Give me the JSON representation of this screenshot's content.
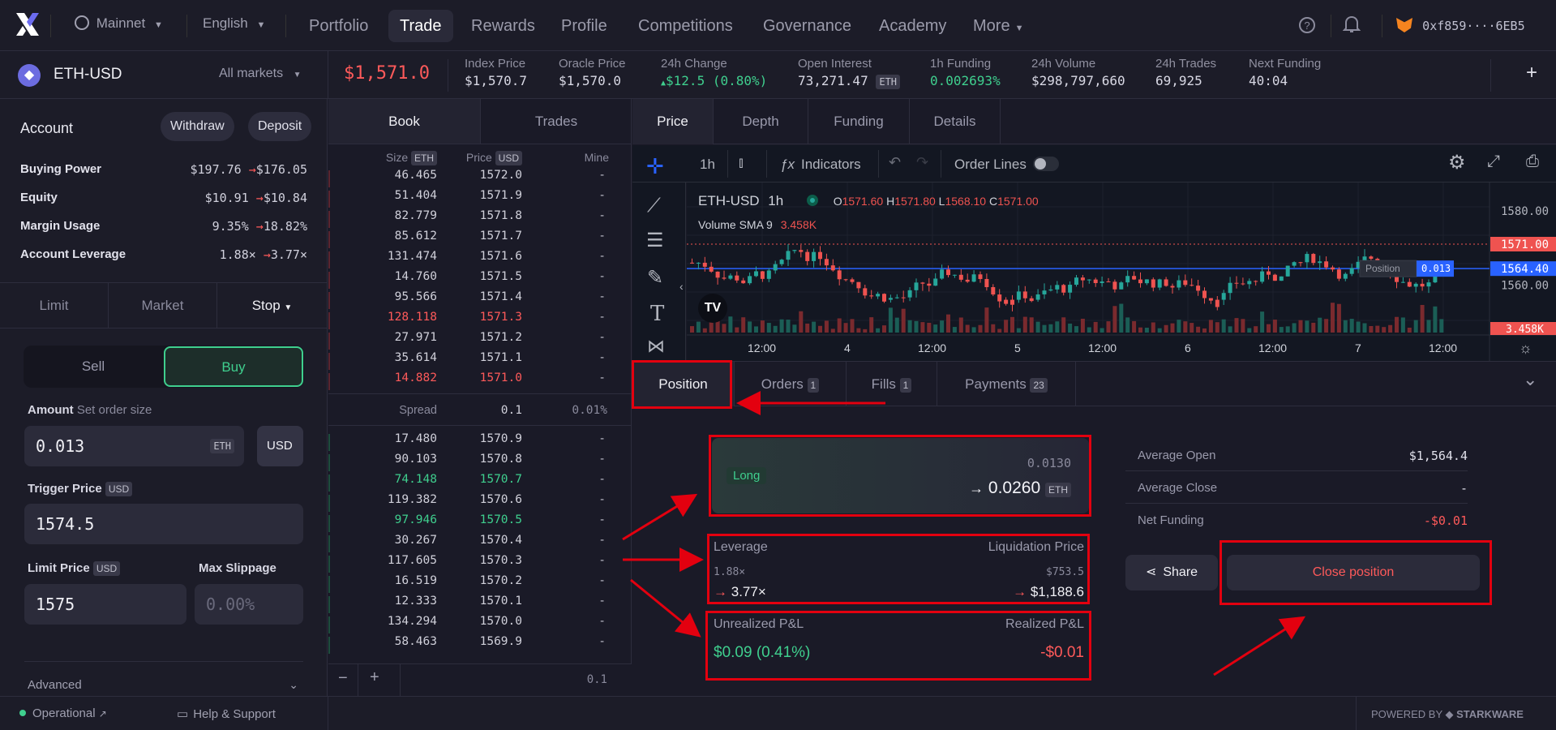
{
  "nav": {
    "network": "Mainnet",
    "language": "English",
    "items": [
      "Portfolio",
      "Trade",
      "Rewards",
      "Profile",
      "Competitions",
      "Governance",
      "Academy",
      "More"
    ],
    "wallet": "0xf859····6EB5"
  },
  "market": {
    "symbol": "ETH-USD",
    "all_markets": "All markets",
    "price": "$1,571.0",
    "stats": [
      {
        "label": "Index Price",
        "value": "$1,570.7"
      },
      {
        "label": "Oracle Price",
        "value": "$1,570.0"
      },
      {
        "label": "24h Change",
        "value": "$12.5 (0.80%)"
      },
      {
        "label": "Open Interest",
        "value": "73,271.47",
        "tag": "ETH"
      },
      {
        "label": "1h Funding",
        "value": "0.002693%"
      },
      {
        "label": "24h Volume",
        "value": "$298,797,660"
      },
      {
        "label": "24h Trades",
        "value": "69,925"
      },
      {
        "label": "Next Funding",
        "value": "40:04"
      }
    ]
  },
  "account": {
    "title": "Account",
    "withdraw": "Withdraw",
    "deposit": "Deposit",
    "rows": [
      {
        "label": "Buying Power",
        "from": "$197.76",
        "to": "$176.05"
      },
      {
        "label": "Equity",
        "from": "$10.91",
        "to": "$10.84"
      },
      {
        "label": "Margin Usage",
        "from": "9.35%",
        "to": "18.82%"
      },
      {
        "label": "Account Leverage",
        "from": "1.88×",
        "to": "3.77×"
      }
    ]
  },
  "order": {
    "tabs": [
      "Limit",
      "Market",
      "Stop"
    ],
    "sell": "Sell",
    "buy": "Buy",
    "amount_label": "Amount",
    "amount_hint": "Set order size",
    "amount_value": "0.013",
    "amount_unit": "ETH",
    "usd_toggle": "USD",
    "trigger_label": "Trigger Price",
    "trigger_unit": "USD",
    "trigger_value": "1574.5",
    "limit_label": "Limit Price",
    "limit_unit": "USD",
    "limit_value": "1575",
    "slippage_label": "Max Slippage",
    "slippage_placeholder": "0.00%",
    "advanced": "Advanced"
  },
  "book": {
    "tabs": [
      "Book",
      "Trades"
    ],
    "headers": {
      "size": "Size",
      "size_unit": "ETH",
      "price": "Price",
      "price_unit": "USD",
      "mine": "Mine"
    },
    "asks": [
      [
        "46.465",
        "1572.0"
      ],
      [
        "51.404",
        "1571.9"
      ],
      [
        "82.779",
        "1571.8"
      ],
      [
        "85.612",
        "1571.7"
      ],
      [
        "131.474",
        "1571.6"
      ],
      [
        "14.760",
        "1571.5"
      ],
      [
        "95.566",
        "1571.4"
      ],
      [
        "128.118",
        "1571.3"
      ],
      [
        "27.971",
        "1571.2"
      ],
      [
        "35.614",
        "1571.1"
      ],
      [
        "14.882",
        "1571.0"
      ]
    ],
    "spread_label": "Spread",
    "spread_value": "0.1",
    "spread_pct": "0.01%",
    "bids": [
      [
        "17.480",
        "1570.9"
      ],
      [
        "90.103",
        "1570.8"
      ],
      [
        "74.148",
        "1570.7"
      ],
      [
        "119.382",
        "1570.6"
      ],
      [
        "97.946",
        "1570.5"
      ],
      [
        "30.267",
        "1570.4"
      ],
      [
        "117.605",
        "1570.3"
      ],
      [
        "16.519",
        "1570.2"
      ],
      [
        "12.333",
        "1570.1"
      ],
      [
        "134.294",
        "1570.0"
      ],
      [
        "58.463",
        "1569.9"
      ]
    ],
    "mine_dash": "-",
    "step": "0.1"
  },
  "chart": {
    "tabs": [
      "Price",
      "Depth",
      "Funding",
      "Details"
    ],
    "interval": "1h",
    "indicators": "Indicators",
    "order_lines": "Order Lines",
    "legend_symbol": "ETH-USD",
    "legend_interval": "1h",
    "o": "1571.60",
    "h": "1571.80",
    "l": "1568.10",
    "c": "1571.00",
    "volume_label": "Volume SMA 9",
    "volume_value": "3.458K",
    "price_labels": [
      "1580.00",
      "1571.00",
      "1564.40",
      "1560.00"
    ],
    "vol_tag": "3.458K",
    "position_tag": "Position",
    "position_qty": "0.013",
    "x_labels": [
      "12:00",
      "4",
      "12:00",
      "5",
      "12:00",
      "6",
      "12:00",
      "7",
      "12:00"
    ]
  },
  "bottom_tabs": [
    {
      "label": "Position"
    },
    {
      "label": "Orders",
      "count": "1"
    },
    {
      "label": "Fills",
      "count": "1"
    },
    {
      "label": "Payments",
      "count": "23"
    }
  ],
  "position": {
    "side": "Long",
    "size_from": "0.0130",
    "size_to": "0.0260",
    "unit": "ETH",
    "leverage_label": "Leverage",
    "leverage_from": "1.88×",
    "leverage_to": "3.77×",
    "liq_label": "Liquidation Price",
    "liq_from": "$753.5",
    "liq_to": "$1,188.6",
    "upnl_label": "Unrealized P&L",
    "upnl_value": "$0.09 (0.41%)",
    "rpnl_label": "Realized P&L",
    "rpnl_value": "-$0.01",
    "avg_open_label": "Average Open",
    "avg_open": "$1,564.4",
    "avg_close_label": "Average Close",
    "avg_close": "-",
    "net_funding_label": "Net Funding",
    "net_funding": "-$0.01",
    "share": "Share",
    "close": "Close position"
  },
  "footer": {
    "status": "Operational",
    "help": "Help & Support",
    "powered": "POWERED BY",
    "brand": "STARKWARE"
  },
  "colors": {
    "red": "#ff5a5a",
    "green": "#3fcf8e",
    "accent": "#5e5ef7",
    "highlight": "#e3000f"
  }
}
